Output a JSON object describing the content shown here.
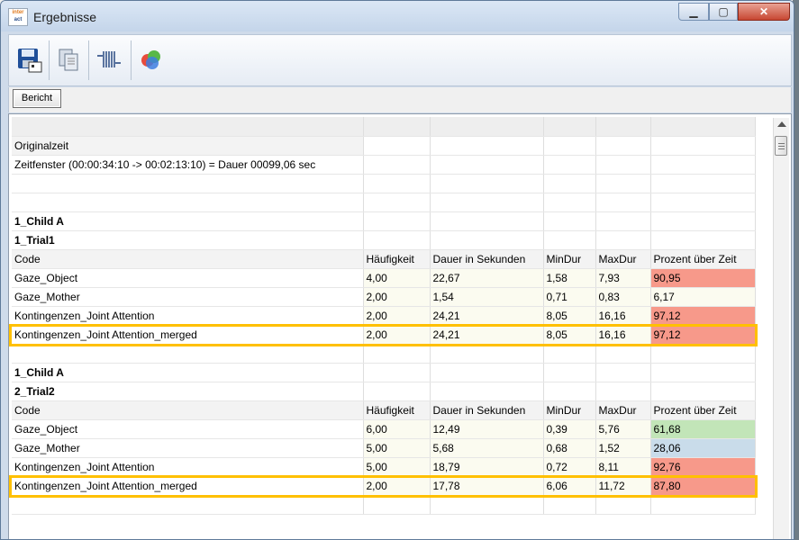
{
  "window": {
    "title": "Ergebnisse",
    "app_icon_text": [
      "inter",
      "act"
    ]
  },
  "controls": {
    "minimize": "▁",
    "maximize": "▢",
    "close": "✕"
  },
  "toolbar": {
    "buttons": [
      {
        "name": "save-icon"
      },
      {
        "name": "copy-icon"
      },
      {
        "name": "columns-icon"
      },
      {
        "name": "color-palette-icon"
      }
    ]
  },
  "tabs": [
    {
      "label": "Bericht"
    }
  ],
  "colors": {
    "red": "#f7998a",
    "green": "#c2e5b8",
    "blue": "#c9dcea",
    "yellow": "#fbfbf0",
    "highlight": "#ffc000"
  },
  "report": {
    "rows": [
      {
        "kind": "blank",
        "cells": [
          "",
          "",
          "",
          "",
          "",
          ""
        ]
      },
      {
        "kind": "label",
        "cells": [
          "Originalzeit",
          "",
          "",
          "",
          "",
          ""
        ]
      },
      {
        "kind": "text",
        "cells": [
          "Zeitfenster  (00:00:34:10 -> 00:02:13:10) = Dauer 00099,06 sec",
          "",
          "",
          "",
          "",
          ""
        ]
      },
      {
        "kind": "blank",
        "cells": [
          "",
          "",
          "",
          "",
          "",
          ""
        ]
      },
      {
        "kind": "blank",
        "cells": [
          "",
          "",
          "",
          "",
          "",
          ""
        ]
      },
      {
        "kind": "title",
        "cells": [
          "1_Child A",
          "",
          "",
          "",
          "",
          ""
        ]
      },
      {
        "kind": "title",
        "cells": [
          "1_Trial1",
          "",
          "",
          "",
          "",
          ""
        ]
      },
      {
        "kind": "head",
        "cells": [
          "Code",
          "Häufigkeit",
          "Dauer in Sekunden",
          "MinDur",
          "MaxDur",
          "Prozent über Zeit"
        ]
      },
      {
        "kind": "data",
        "pct": "red",
        "cells": [
          "Gaze_Object",
          "4,00",
          "22,67",
          "1,58",
          "7,93",
          "90,95"
        ]
      },
      {
        "kind": "data",
        "pct": "yellow",
        "cells": [
          "Gaze_Mother",
          "2,00",
          "1,54",
          "0,71",
          "0,83",
          "6,17"
        ]
      },
      {
        "kind": "data",
        "pct": "red",
        "cells": [
          "Kontingenzen_Joint Attention",
          "2,00",
          "24,21",
          "8,05",
          "16,16",
          "97,12"
        ]
      },
      {
        "kind": "data",
        "pct": "red",
        "highlight": true,
        "cells": [
          "Kontingenzen_Joint Attention_merged",
          "2,00",
          "24,21",
          "8,05",
          "16,16",
          "97,12"
        ]
      },
      {
        "kind": "blank",
        "cells": [
          "",
          "",
          "",
          "",
          "",
          ""
        ]
      },
      {
        "kind": "title",
        "cells": [
          "1_Child A",
          "",
          "",
          "",
          "",
          ""
        ]
      },
      {
        "kind": "title",
        "cells": [
          "2_Trial2",
          "",
          "",
          "",
          "",
          ""
        ]
      },
      {
        "kind": "head",
        "cells": [
          "Code",
          "Häufigkeit",
          "Dauer in Sekunden",
          "MinDur",
          "MaxDur",
          "Prozent über Zeit"
        ]
      },
      {
        "kind": "data",
        "pct": "green",
        "cells": [
          "Gaze_Object",
          "6,00",
          "12,49",
          "0,39",
          "5,76",
          "61,68"
        ]
      },
      {
        "kind": "data",
        "pct": "blue",
        "cells": [
          "Gaze_Mother",
          "5,00",
          "5,68",
          "0,68",
          "1,52",
          "28,06"
        ]
      },
      {
        "kind": "data",
        "pct": "red",
        "cells": [
          "Kontingenzen_Joint Attention",
          "5,00",
          "18,79",
          "0,72",
          "8,11",
          "92,76"
        ]
      },
      {
        "kind": "data",
        "pct": "red",
        "highlight": true,
        "cells": [
          "Kontingenzen_Joint Attention_merged",
          "2,00",
          "17,78",
          "6,06",
          "11,72",
          "87,80"
        ]
      },
      {
        "kind": "blank",
        "cells": [
          "",
          "",
          "",
          "",
          "",
          ""
        ]
      }
    ]
  }
}
